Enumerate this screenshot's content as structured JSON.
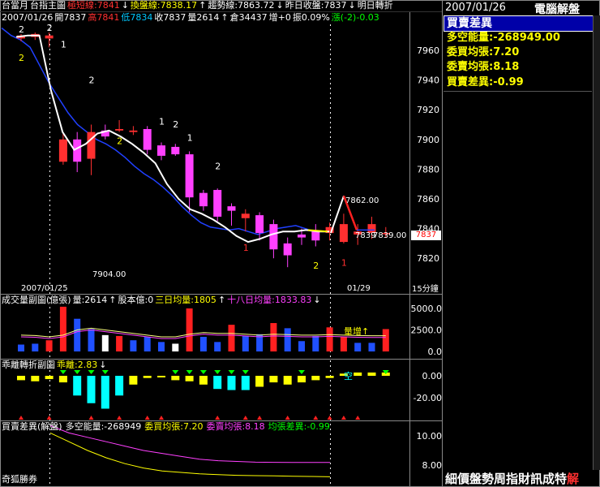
{
  "header": {
    "row1": [
      {
        "text": "台當月",
        "color": "#ffffff"
      },
      {
        "text": "台指主圖",
        "color": "#ffffff"
      },
      {
        "text": "極短線:7841",
        "color": "#ff3030"
      },
      {
        "text": "↓",
        "color": "#ffffff"
      },
      {
        "text": "換盤線:7838.17",
        "color": "#ffff00"
      },
      {
        "text": "↑",
        "color": "#ffffff"
      },
      {
        "text": "趨勢線:7863.72",
        "color": "#ffffff"
      },
      {
        "text": "↓",
        "color": "#ffffff"
      },
      {
        "text": "昨日收盤:7837",
        "color": "#ffffff"
      },
      {
        "text": "↓",
        "color": "#ffffff"
      },
      {
        "text": "明日轉折",
        "color": "#ffffff"
      }
    ],
    "row2": [
      {
        "text": "2007/01/26",
        "color": "#ffffff"
      },
      {
        "text": "開7837",
        "color": "#ffffff"
      },
      {
        "text": "高7841",
        "color": "#ff3030"
      },
      {
        "text": "低7834",
        "color": "#00c8ff"
      },
      {
        "text": "收7837",
        "color": "#ffffff"
      },
      {
        "text": "量2614",
        "color": "#ffffff"
      },
      {
        "text": "↑",
        "color": "#ffffff"
      },
      {
        "text": "倉34437",
        "color": "#ffffff"
      },
      {
        "text": "增+0",
        "color": "#ffffff"
      },
      {
        "text": "振0.09%",
        "color": "#ffffff"
      },
      {
        "text": "漲(-2)-0.03",
        "color": "#00ff00"
      }
    ]
  },
  "main_chart": {
    "y_ticks": [
      "7960",
      "7940",
      "7920",
      "7900",
      "7880",
      "7860",
      "7840",
      "7820"
    ],
    "candles": [
      {
        "o": 7968,
        "c": 7970,
        "h": 7971,
        "l": 7966
      },
      {
        "o": 7969,
        "c": 7971,
        "h": 7972,
        "l": 7967
      },
      {
        "o": 7968,
        "c": 7970,
        "h": 7972,
        "l": 7962
      },
      {
        "o": 7885,
        "c": 7900,
        "h": 7904,
        "l": 7883
      },
      {
        "o": 7900,
        "c": 7885,
        "h": 7905,
        "l": 7878
      },
      {
        "o": 7887,
        "c": 7905,
        "h": 7910,
        "l": 7876
      },
      {
        "o": 7906,
        "c": 7902,
        "h": 7910,
        "l": 7900
      },
      {
        "o": 7906,
        "c": 7907,
        "h": 7913,
        "l": 7905
      },
      {
        "o": 7905,
        "c": 7906,
        "h": 7909,
        "l": 7903
      },
      {
        "o": 7907,
        "c": 7893,
        "h": 7909,
        "l": 7890
      },
      {
        "o": 7896,
        "c": 7889,
        "h": 7898,
        "l": 7886
      },
      {
        "o": 7895,
        "c": 7890,
        "h": 7897,
        "l": 7889
      },
      {
        "o": 7890,
        "c": 7861,
        "h": 7892,
        "l": 7851
      },
      {
        "o": 7864,
        "c": 7855,
        "h": 7866,
        "l": 7852
      },
      {
        "o": 7866,
        "c": 7848,
        "h": 7867,
        "l": 7845
      },
      {
        "o": 7855,
        "c": 7852,
        "h": 7857,
        "l": 7842
      },
      {
        "o": 7847,
        "c": 7850,
        "h": 7853,
        "l": 7838
      },
      {
        "o": 7849,
        "c": 7837,
        "h": 7851,
        "l": 7832
      },
      {
        "o": 7843,
        "c": 7826,
        "h": 7846,
        "l": 7820
      },
      {
        "o": 7830,
        "c": 7822,
        "h": 7834,
        "l": 7814
      },
      {
        "o": 7836,
        "c": 7834,
        "h": 7840,
        "l": 7829
      },
      {
        "o": 7838,
        "c": 7832,
        "h": 7843,
        "l": 7828
      },
      {
        "o": 7837,
        "c": 7841,
        "h": 7844,
        "l": 7832
      },
      {
        "o": 7831,
        "c": 7843,
        "h": 7850,
        "l": 7830
      },
      {
        "o": 7836,
        "c": 7838,
        "h": 7843,
        "l": 7829
      },
      {
        "o": 7837,
        "c": 7843,
        "h": 7848,
        "l": 7833
      },
      {
        "o": 7837,
        "c": 7837,
        "h": 7841,
        "l": 7834
      }
    ],
    "trend_line": [
      7975,
      7970,
      7967,
      7962,
      7950,
      7938,
      7928,
      7918,
      7910,
      7905,
      7900,
      7897,
      7893,
      7888,
      7882,
      7877,
      7873,
      7868,
      7862,
      7855,
      7849,
      7844,
      7841,
      7840,
      7839,
      7840,
      7838,
      7836,
      7838,
      7840,
      7841,
      7842,
      7840,
      7838,
      7838
    ],
    "fast_line": [
      7969,
      7970,
      7970,
      7933,
      7905,
      7893,
      7897,
      7904,
      7906,
      7902,
      7897,
      7891,
      7884,
      7870,
      7860,
      7853,
      7850,
      7846,
      7841,
      7835,
      7831,
      7833,
      7836,
      7838,
      7838,
      7839,
      7838,
      7838
    ],
    "projection": [
      7837,
      7862,
      7839
    ],
    "labels": [
      {
        "text": "2",
        "color": "#ffffff",
        "i": 0,
        "v": 7972
      },
      {
        "text": "2",
        "color": "#ffff00",
        "i": 0,
        "v": 7953
      },
      {
        "text": "2",
        "color": "#ffffff",
        "i": 2,
        "v": 7973
      },
      {
        "text": "1",
        "color": "#ffffff",
        "i": 3,
        "v": 7962
      },
      {
        "text": "2",
        "color": "#ffffff",
        "i": 5,
        "v": 7938
      },
      {
        "text": "2",
        "color": "#ffff00",
        "i": 7,
        "v": 7897
      },
      {
        "text": "1",
        "color": "#ffffff",
        "i": 10,
        "v": 7910
      },
      {
        "text": "2",
        "color": "#ffffff",
        "i": 11,
        "v": 7908
      },
      {
        "text": "1",
        "color": "#ffffff",
        "i": 12,
        "v": 7899
      },
      {
        "text": "2",
        "color": "#ffffff",
        "i": 14,
        "v": 7880
      },
      {
        "text": "1",
        "color": "#ff3030",
        "i": 16,
        "v": 7825
      },
      {
        "text": "2",
        "color": "#ffff00",
        "i": 21,
        "v": 7813
      },
      {
        "text": "1",
        "color": "#ff3030",
        "i": 23,
        "v": 7815
      }
    ],
    "price_862": "7862.00",
    "price_839": "7839.00",
    "price_839b": "7839",
    "price_904": "7904.00",
    "last_price_badge": "7837",
    "date_left": "2007/01/25",
    "date_right": "01/29",
    "interval": "15分鐘"
  },
  "volume_panel": {
    "header": [
      {
        "text": "成交量副圖(億張)",
        "color": "#ffffff"
      },
      {
        "text": "量:2614",
        "color": "#ffffff"
      },
      {
        "text": "↑",
        "color": "#ffffff"
      },
      {
        "text": "股本億:0",
        "color": "#ffffff"
      },
      {
        "text": "三日均量:1805",
        "color": "#ffff00"
      },
      {
        "text": "↑",
        "color": "#ffffff"
      },
      {
        "text": "十八日均量:1833.83",
        "color": "#ff40ff"
      },
      {
        "text": "↓",
        "color": "#ffffff"
      }
    ],
    "y_ticks": [
      "5000.0",
      "2500.0",
      "0.0"
    ],
    "bars": [
      {
        "v": 800,
        "c": "#2050ff"
      },
      {
        "v": 900,
        "c": "#2050ff"
      },
      {
        "v": 1300,
        "c": "#ff2020"
      },
      {
        "v": 5200,
        "c": "#ff2020"
      },
      {
        "v": 3800,
        "c": "#2050ff"
      },
      {
        "v": 2600,
        "c": "#2050ff"
      },
      {
        "v": 1900,
        "c": "#ffffff"
      },
      {
        "v": 1800,
        "c": "#ff2020"
      },
      {
        "v": 1300,
        "c": "#2050ff"
      },
      {
        "v": 1700,
        "c": "#2050ff"
      },
      {
        "v": 1100,
        "c": "#2050ff"
      },
      {
        "v": 900,
        "c": "#ffffff"
      },
      {
        "v": 5000,
        "c": "#ff2020"
      },
      {
        "v": 1700,
        "c": "#2050ff"
      },
      {
        "v": 1100,
        "c": "#2050ff"
      },
      {
        "v": 3100,
        "c": "#ff2020"
      },
      {
        "v": 1800,
        "c": "#2050ff"
      },
      {
        "v": 2000,
        "c": "#2050ff"
      },
      {
        "v": 3300,
        "c": "#ff2020"
      },
      {
        "v": 2700,
        "c": "#2050ff"
      },
      {
        "v": 1200,
        "c": "#2050ff"
      },
      {
        "v": 1800,
        "c": "#2050ff"
      },
      {
        "v": 2800,
        "c": "#ff2020"
      },
      {
        "v": 1700,
        "c": "#ff2020"
      },
      {
        "v": 1000,
        "c": "#2050ff"
      },
      {
        "v": 1000,
        "c": "#2050ff"
      },
      {
        "v": 2600,
        "c": "#ff2020"
      }
    ],
    "avg_line": [
      1900,
      1850,
      1700,
      1900,
      2500,
      2700,
      2500,
      2300,
      2100,
      1900,
      1700,
      1700,
      2000,
      2200,
      2100,
      2100,
      2000,
      1900,
      2000,
      1950,
      1900,
      1900,
      1950,
      1900,
      1850,
      1830,
      1833
    ],
    "tag": "量增↑"
  },
  "deviation_panel": {
    "header": [
      {
        "text": "乖離轉折副圖",
        "color": "#ffffff"
      },
      {
        "text": "乖離:2.83",
        "color": "#ffff00"
      },
      {
        "text": "↓",
        "color": "#ffffff"
      }
    ],
    "y_ticks": [
      "0.00",
      "-20.00"
    ],
    "bars": [
      -4,
      -5,
      -3,
      -6,
      -18,
      -25,
      -30,
      -18,
      -8,
      -2,
      -1,
      -4,
      -5,
      -8,
      -12,
      -13,
      -13,
      -10,
      -6,
      -8,
      -6,
      -4,
      -2,
      2,
      3,
      3,
      3
    ],
    "green_markers": [
      3,
      4,
      5,
      6,
      11,
      12,
      13,
      14,
      15,
      16,
      20,
      26
    ],
    "red_markers": [
      0,
      2,
      5,
      7,
      9,
      10,
      14,
      16,
      17,
      19,
      21,
      22,
      23,
      24
    ],
    "tag": "空"
  },
  "buysell_panel": {
    "header": [
      {
        "text": "買賣差異(解盤)",
        "color": "#ffffff"
      },
      {
        "text": "多空能量:-268949",
        "color": "#ffffff"
      },
      {
        "text": "委買均張:7.20",
        "color": "#ffff00"
      },
      {
        "text": "委賣均張:8.18",
        "color": "#ff40ff"
      },
      {
        "text": "均張差異:-0.99",
        "color": "#00ff00"
      }
    ],
    "y_ticks": [
      "10.00",
      "8.00"
    ],
    "buy_line": [
      10.7,
      10.2,
      9.9,
      9.6,
      9.3,
      9.0,
      8.8,
      8.6,
      8.4,
      8.3,
      8.25,
      8.2,
      8.19,
      8.18,
      8.18,
      8.18
    ],
    "sell_line": [
      10.2,
      9.6,
      9.0,
      8.5,
      8.1,
      7.8,
      7.6,
      7.5,
      7.4,
      7.35,
      7.3,
      7.28,
      7.26,
      7.24,
      7.22,
      7.2
    ],
    "footer_left": "奇狐勝券"
  },
  "right_panel": {
    "date": "2007/01/26",
    "brand": "電腦解盤",
    "title": "買賣差異",
    "fields": [
      {
        "label": "多空能量:-268949.00",
        "color": "#ffff00"
      },
      {
        "label": "委買均張:7.20",
        "color": "#ffff00"
      },
      {
        "label": "委賣均張:8.18",
        "color": "#ffff00"
      },
      {
        "label": "買賣差異:-0.99",
        "color": "#ffff00"
      }
    ],
    "footer_prefix": "細價盤勢周指財訊成特",
    "footer_accent": "解",
    "colors": {
      "title_bg": "#0000a8",
      "footer_bg": "#000000",
      "frame": "#888888"
    }
  }
}
